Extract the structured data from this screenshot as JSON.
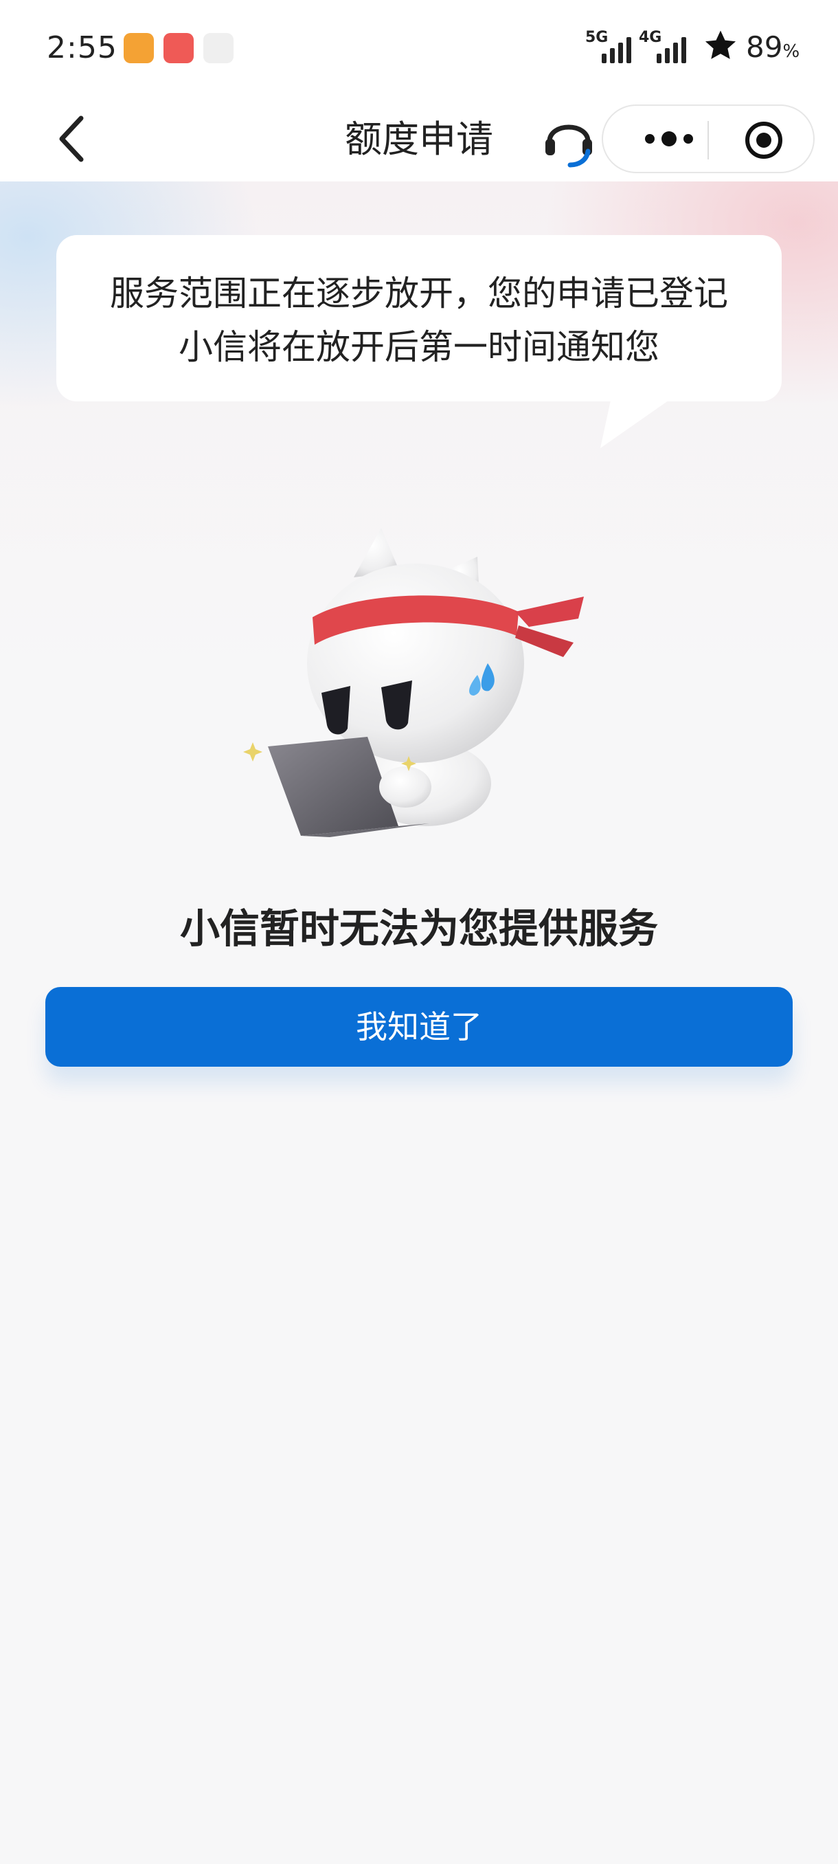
{
  "status_bar": {
    "time": "2:55",
    "signal_1": "5G",
    "signal_2": "4G",
    "battery": "89",
    "battery_unit": "%"
  },
  "nav": {
    "title": "额度申请",
    "back_icon": "chevron-left-icon",
    "support_icon": "headset-icon",
    "more_icon": "more-dots-icon",
    "close_icon": "target-circle-icon"
  },
  "bubble": {
    "line1": "服务范围正在逐步放开，您的申请已登记",
    "line2": "小信将在放开后第一时间通知您"
  },
  "main": {
    "headline": "小信暂时无法为您提供服务",
    "button_label": "我知道了"
  },
  "colors": {
    "primary": "#0a6fd6",
    "headband": "#e0474c",
    "background": "#f7f7f8"
  }
}
